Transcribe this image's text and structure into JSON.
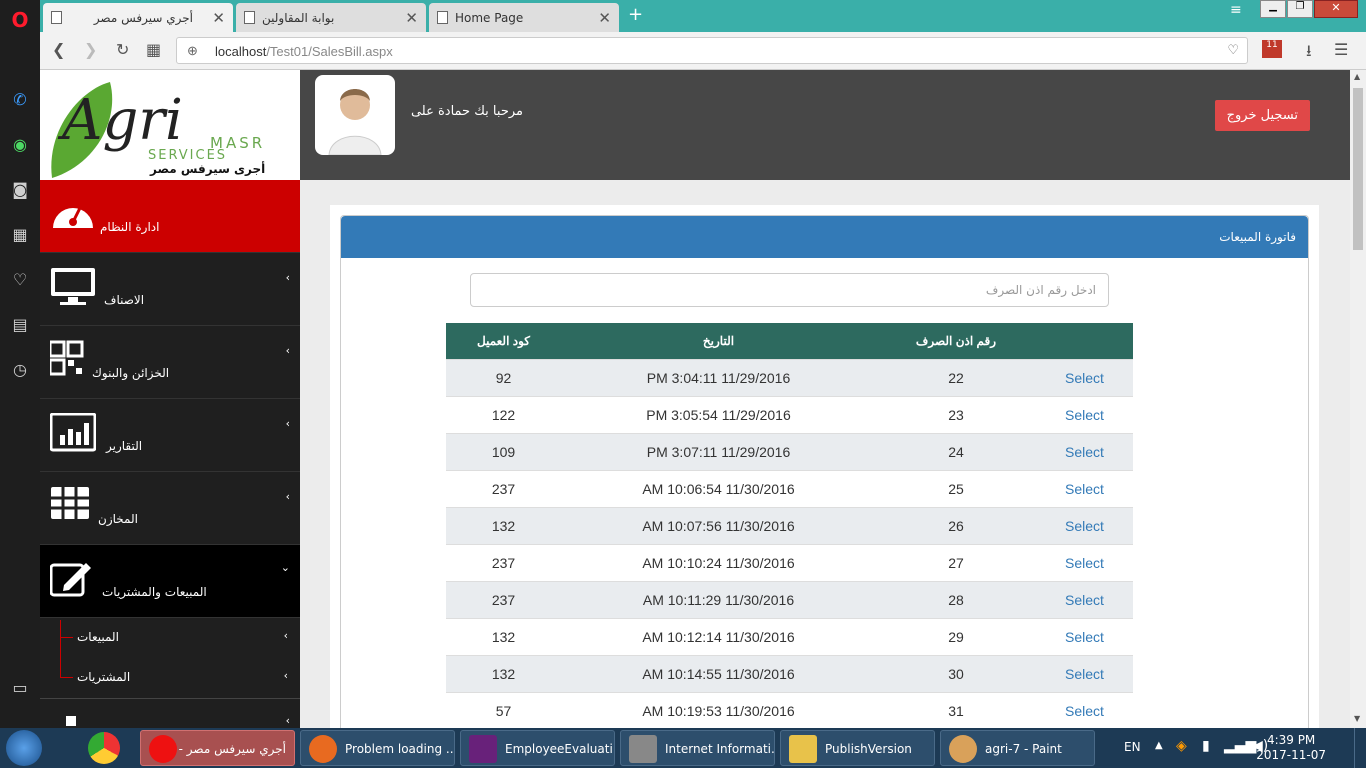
{
  "browser": {
    "tabs": [
      {
        "title": "أجري سيرفس مصر"
      },
      {
        "title": "بوابة المقاولين"
      },
      {
        "title": "Home Page"
      }
    ],
    "url_host": "localhost",
    "url_path": "/Test01/SalesBill.aspx",
    "mail_badge": "11"
  },
  "logo": {
    "brand": "Agri",
    "line1": "MASR",
    "line2": "SERVICES",
    "arabic": "أجرى سيرفس مصر"
  },
  "header": {
    "welcome": "مرحبا بك حمادة على",
    "logout": "تسجيل خروج"
  },
  "sidebar": {
    "items": [
      {
        "label": "ادارة النظام",
        "icon": "dashboard-icon"
      },
      {
        "label": "الاصناف",
        "icon": "monitor-icon"
      },
      {
        "label": "الخزائن والبنوك",
        "icon": "qr-icon"
      },
      {
        "label": "التقارير",
        "icon": "bar-chart-icon"
      },
      {
        "label": "المخازن",
        "icon": "grid-icon"
      },
      {
        "label": "المبيعات والمشتريات",
        "icon": "edit-icon"
      }
    ],
    "subitems": [
      {
        "label": "المبيعات"
      },
      {
        "label": "المشتريات"
      }
    ]
  },
  "panel": {
    "title": "فاتورة المبيعات",
    "search_placeholder": "ادخل رقم اذن الصرف",
    "columns": [
      "كود العميل",
      "التاريخ",
      "رقم اذن الصرف",
      ""
    ],
    "rows": [
      {
        "client": "92",
        "date": "PM 3:04:11 11/29/2016",
        "num": "22",
        "action": "Select"
      },
      {
        "client": "122",
        "date": "PM 3:05:54 11/29/2016",
        "num": "23",
        "action": "Select"
      },
      {
        "client": "109",
        "date": "PM 3:07:11 11/29/2016",
        "num": "24",
        "action": "Select"
      },
      {
        "client": "237",
        "date": "AM 10:06:54 11/30/2016",
        "num": "25",
        "action": "Select"
      },
      {
        "client": "132",
        "date": "AM 10:07:56 11/30/2016",
        "num": "26",
        "action": "Select"
      },
      {
        "client": "237",
        "date": "AM 10:10:24 11/30/2016",
        "num": "27",
        "action": "Select"
      },
      {
        "client": "237",
        "date": "AM 10:11:29 11/30/2016",
        "num": "28",
        "action": "Select"
      },
      {
        "client": "132",
        "date": "AM 10:12:14 11/30/2016",
        "num": "29",
        "action": "Select"
      },
      {
        "client": "132",
        "date": "AM 10:14:55 11/30/2016",
        "num": "30",
        "action": "Select"
      },
      {
        "client": "57",
        "date": "AM 10:19:53 11/30/2016",
        "num": "31",
        "action": "Select"
      }
    ]
  },
  "taskbar": {
    "items": [
      {
        "label": "أجري سيرفس مصر - ..."
      },
      {
        "label": "Problem loading ..."
      },
      {
        "label": "EmployeeEvaluati..."
      },
      {
        "label": "Internet Informati..."
      },
      {
        "label": "PublishVersion"
      },
      {
        "label": "agri-7 - Paint"
      }
    ],
    "lang": "EN",
    "time": "4:39 PM",
    "date": "2017-11-07"
  },
  "colors": {
    "accent_red": "#cc0000",
    "header_blue": "#337ab7",
    "table_head": "#2d6a5f",
    "logout_red": "#e04848"
  }
}
